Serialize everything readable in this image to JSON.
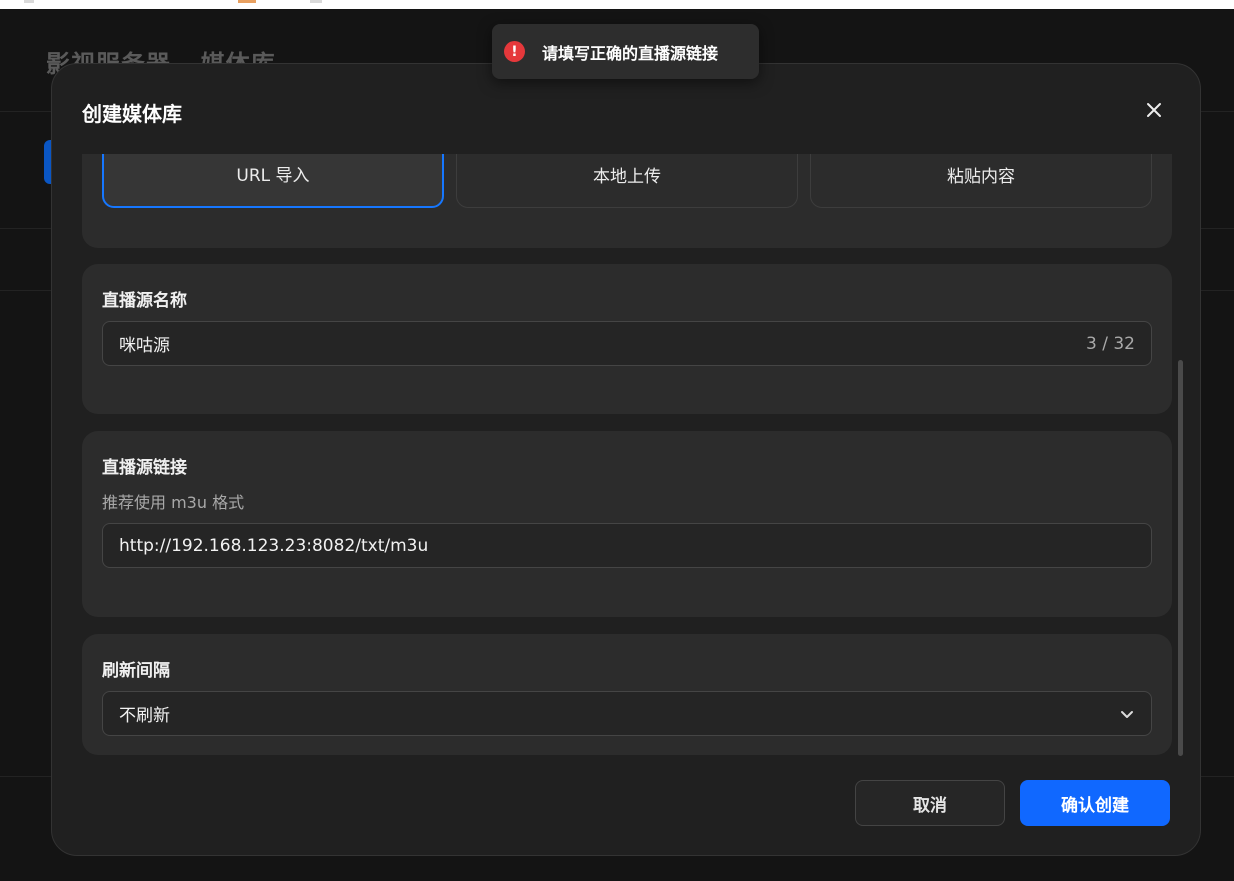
{
  "background": {
    "title": "影视服务器 - 媒体库"
  },
  "toast": {
    "icon": "error-icon",
    "color": "#e5383b",
    "message": "请填写正确的直播源链接"
  },
  "modal": {
    "title": "创建媒体库",
    "close_icon": "close-icon",
    "import_methods": [
      {
        "label": "URL 导入",
        "icon": "import-icon",
        "selected": true
      },
      {
        "label": "本地上传",
        "icon": "upload-icon",
        "selected": false
      },
      {
        "label": "粘贴内容",
        "icon": "paste-icon",
        "selected": false
      }
    ],
    "name_field": {
      "label": "直播源名称",
      "value": "咪咕源",
      "counter": "3 / 32"
    },
    "link_field": {
      "label": "直播源链接",
      "hint": "推荐使用 m3u 格式",
      "value": "http://192.168.123.23:8082/txt/m3u"
    },
    "refresh_field": {
      "label": "刷新间隔",
      "value": "不刷新"
    },
    "buttons": {
      "cancel": "取消",
      "confirm": "确认创建"
    },
    "accent_color": "#1068ff"
  }
}
